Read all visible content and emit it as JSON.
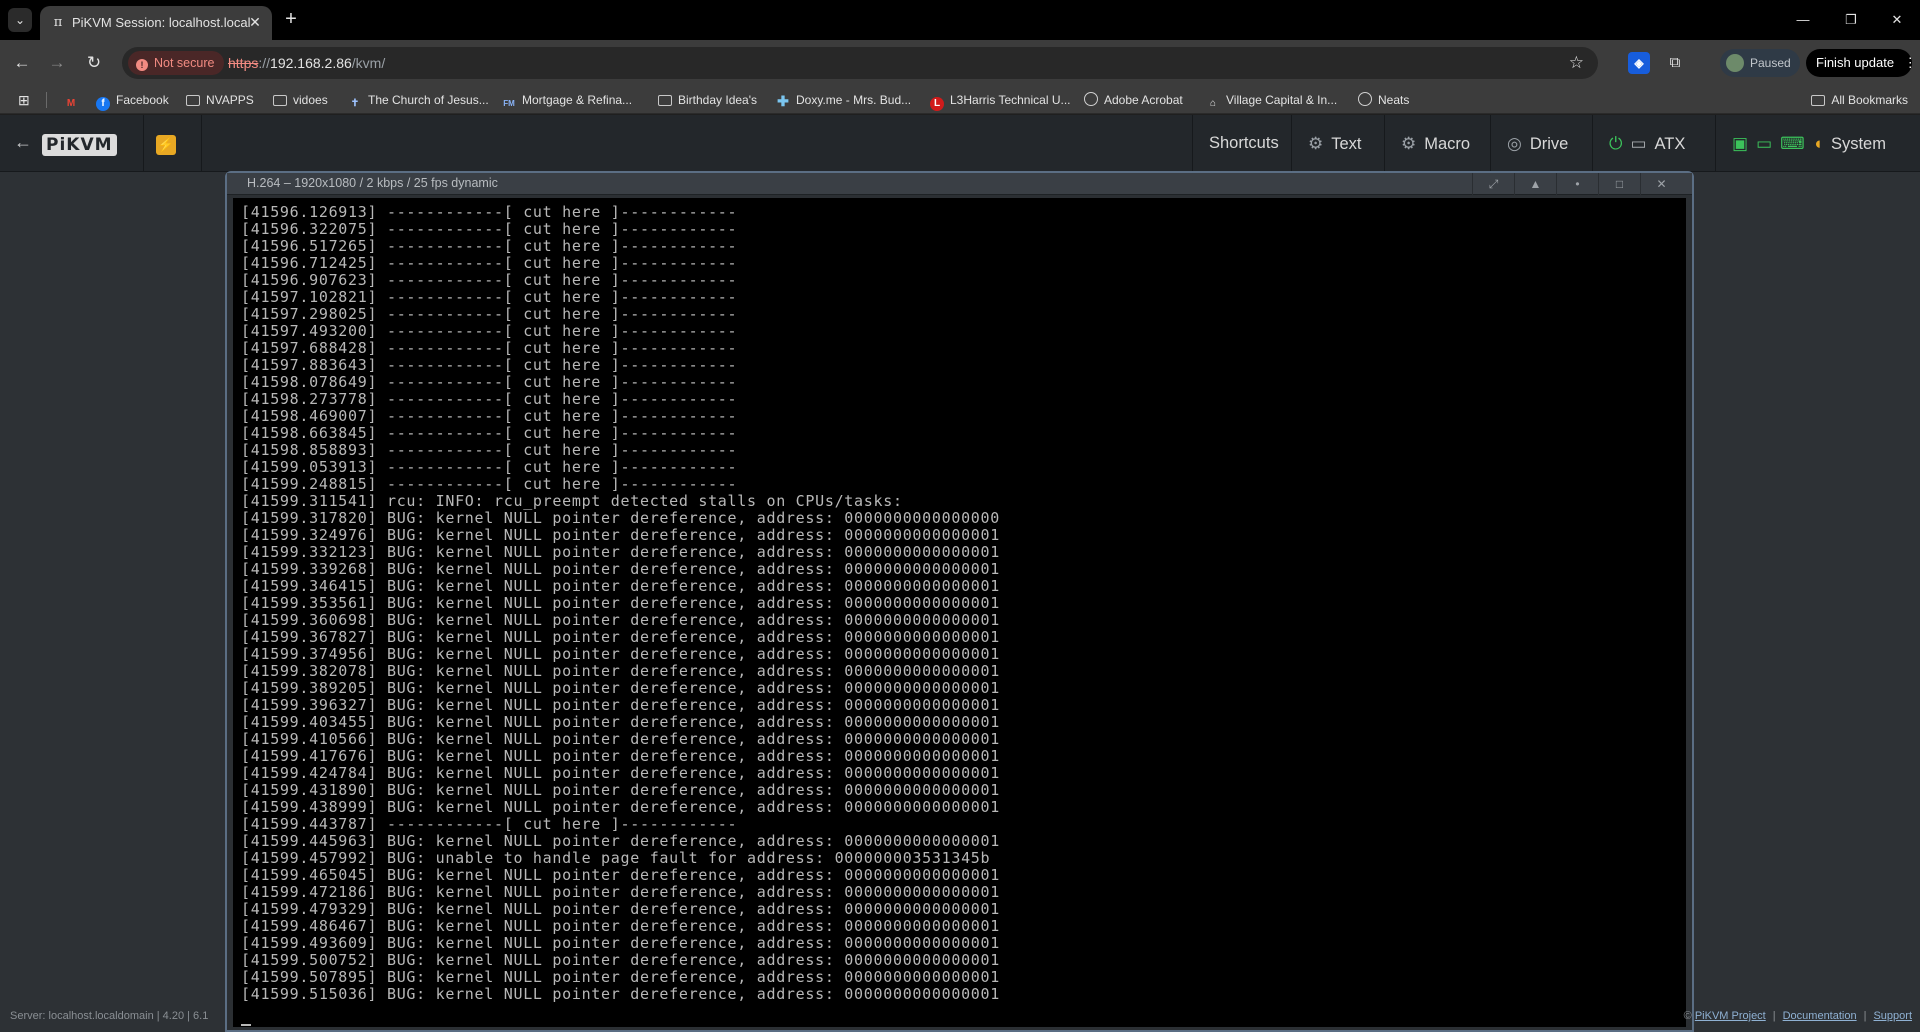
{
  "browser": {
    "tab": {
      "title": "PiKVM Session: localhost.locald",
      "close": "✕"
    },
    "new_tab": "+",
    "window_controls": {
      "minimize": "—",
      "restore": "❐",
      "close": "✕"
    },
    "nav": {
      "back": "←",
      "forward": "→",
      "reload": "↻"
    },
    "security_chip": "Not secure",
    "url": {
      "scheme": "https",
      "sep": "://",
      "host": "192.168.2.86",
      "path": "/kvm/"
    },
    "profile_status": "Paused",
    "update_button": "Finish update",
    "update_menu": "⋮",
    "bookmarks": [
      {
        "label": "",
        "icon": "gmail-icon"
      },
      {
        "label": "Facebook",
        "icon": "facebook-icon"
      },
      {
        "label": "NVAPPS",
        "icon": "folder-icon"
      },
      {
        "label": "vidoes",
        "icon": "folder-icon"
      },
      {
        "label": "The Church of Jesus...",
        "icon": "church-icon"
      },
      {
        "label": "Mortgage & Refina...",
        "icon": "fm-icon"
      },
      {
        "label": "Birthday Idea's",
        "icon": "folder-icon"
      },
      {
        "label": "Doxy.me - Mrs. Bud...",
        "icon": "doxy-icon"
      },
      {
        "label": "L3Harris Technical U...",
        "icon": "l3harris-icon"
      },
      {
        "label": "Adobe Acrobat",
        "icon": "globe-icon"
      },
      {
        "label": "Village Capital & In...",
        "icon": "village-capital-icon"
      },
      {
        "label": "Neats",
        "icon": "globe-icon"
      }
    ],
    "all_bookmarks": "All Bookmarks"
  },
  "kvm": {
    "logo": "PiKVM",
    "menu": [
      {
        "label": "Shortcuts"
      },
      {
        "label": "Text"
      },
      {
        "label": "Macro"
      },
      {
        "label": "Drive"
      },
      {
        "label": "ATX"
      },
      {
        "label": "System"
      }
    ],
    "stream": {
      "title": "H.264 – 1920x1080 / 2 kbps / 25 fps dynamic",
      "buttons": [
        "⤢",
        "▲",
        "•",
        "□",
        "✕"
      ]
    },
    "console_lines": [
      "[41596.126913] ------------[ cut here ]------------",
      "[41596.322075] ------------[ cut here ]------------",
      "[41596.517265] ------------[ cut here ]------------",
      "[41596.712425] ------------[ cut here ]------------",
      "[41596.907623] ------------[ cut here ]------------",
      "[41597.102821] ------------[ cut here ]------------",
      "[41597.298025] ------------[ cut here ]------------",
      "[41597.493200] ------------[ cut here ]------------",
      "[41597.688428] ------------[ cut here ]------------",
      "[41597.883643] ------------[ cut here ]------------",
      "[41598.078649] ------------[ cut here ]------------",
      "[41598.273778] ------------[ cut here ]------------",
      "[41598.469007] ------------[ cut here ]------------",
      "[41598.663845] ------------[ cut here ]------------",
      "[41598.858893] ------------[ cut here ]------------",
      "[41599.053913] ------------[ cut here ]------------",
      "[41599.248815] ------------[ cut here ]------------",
      "[41599.311541] rcu: INFO: rcu_preempt detected stalls on CPUs/tasks:",
      "[41599.317820] BUG: kernel NULL pointer dereference, address: 0000000000000000",
      "[41599.324976] BUG: kernel NULL pointer dereference, address: 0000000000000001",
      "[41599.332123] BUG: kernel NULL pointer dereference, address: 0000000000000001",
      "[41599.339268] BUG: kernel NULL pointer dereference, address: 0000000000000001",
      "[41599.346415] BUG: kernel NULL pointer dereference, address: 0000000000000001",
      "[41599.353561] BUG: kernel NULL pointer dereference, address: 0000000000000001",
      "[41599.360698] BUG: kernel NULL pointer dereference, address: 0000000000000001",
      "[41599.367827] BUG: kernel NULL pointer dereference, address: 0000000000000001",
      "[41599.374956] BUG: kernel NULL pointer dereference, address: 0000000000000001",
      "[41599.382078] BUG: kernel NULL pointer dereference, address: 0000000000000001",
      "[41599.389205] BUG: kernel NULL pointer dereference, address: 0000000000000001",
      "[41599.396327] BUG: kernel NULL pointer dereference, address: 0000000000000001",
      "[41599.403455] BUG: kernel NULL pointer dereference, address: 0000000000000001",
      "[41599.410566] BUG: kernel NULL pointer dereference, address: 0000000000000001",
      "[41599.417676] BUG: kernel NULL pointer dereference, address: 0000000000000001",
      "[41599.424784] BUG: kernel NULL pointer dereference, address: 0000000000000001",
      "[41599.431890] BUG: kernel NULL pointer dereference, address: 0000000000000001",
      "[41599.438999] BUG: kernel NULL pointer dereference, address: 0000000000000001",
      "[41599.443787] ------------[ cut here ]------------",
      "[41599.445963] BUG: kernel NULL pointer dereference, address: 0000000000000001",
      "[41599.457992] BUG: unable to handle page fault for address: 000000003531345b",
      "[41599.465045] BUG: kernel NULL pointer dereference, address: 0000000000000001",
      "[41599.472186] BUG: kernel NULL pointer dereference, address: 0000000000000001",
      "[41599.479329] BUG: kernel NULL pointer dereference, address: 0000000000000001",
      "[41599.486467] BUG: kernel NULL pointer dereference, address: 0000000000000001",
      "[41599.493609] BUG: kernel NULL pointer dereference, address: 0000000000000001",
      "[41599.500752] BUG: kernel NULL pointer dereference, address: 0000000000000001",
      "[41599.507895] BUG: kernel NULL pointer dereference, address: 0000000000000001",
      "[41599.515036] BUG: kernel NULL pointer dereference, address: 0000000000000001"
    ],
    "footer_left": "Server: localhost.localdomain  |  4.20  |  6.1",
    "footer_links": [
      "PiKVM Project",
      "Documentation",
      "Support"
    ],
    "footer_sep": "|",
    "footer_prefix": "©"
  }
}
